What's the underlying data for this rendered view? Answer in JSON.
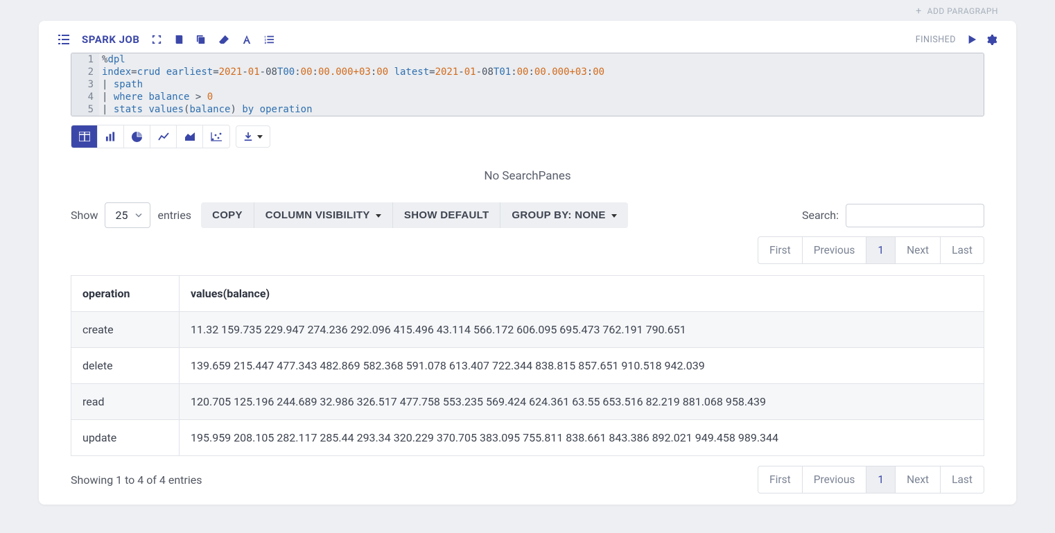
{
  "topbar": {
    "add_paragraph": "ADD PARAGRAPH"
  },
  "header": {
    "title": "SPARK JOB",
    "status": "FINISHED"
  },
  "editor": {
    "lines": [
      "1",
      "2",
      "3",
      "4",
      "5"
    ]
  },
  "code": {
    "l1_pct": "%",
    "l1_dpl": "dpl",
    "l2_index": "index",
    "l2_eq1": "=",
    "l2_crud": "crud",
    "l2_sp1": " ",
    "l2_earliest": "earliest",
    "l2_eq2": "=",
    "l2_2021a": "2021",
    "l2_da1": "-",
    "l2_01a": "01",
    "l2_da2": "-08",
    "l2_T1": "T00",
    "l2_c1": ":",
    "l2_00a": "00",
    "l2_c2": ":",
    "l2_tail1": "00.000+03",
    "l2_c3": ":",
    "l2_00b": "00",
    "l2_sp2": " ",
    "l2_latest": "latest",
    "l2_eq3": "=",
    "l2_2021b": "2021",
    "l2_da3": "-",
    "l2_01b": "01",
    "l2_da4": "-08",
    "l2_T2": "T01",
    "l2_c4": ":",
    "l2_00c": "00",
    "l2_c5": ":",
    "l2_tail2": "00.000+03",
    "l2_c6": ":",
    "l2_00d": "00",
    "l3_pipe": "| ",
    "l3_spath": "spath",
    "l4_pipe": "| ",
    "l4_where": "where",
    "l4_sp": " ",
    "l4_balance": "balance",
    "l4_gt": " > ",
    "l4_zero": "0",
    "l5_pipe": "| ",
    "l5_stats": "stats",
    "l5_sp1": " ",
    "l5_values": "values",
    "l5_lp": "(",
    "l5_balance": "balance",
    "l5_rp": ")",
    "l5_sp2": " ",
    "l5_by": "by",
    "l5_sp3": " ",
    "l5_operation": "operation"
  },
  "panes": {
    "none": "No SearchPanes"
  },
  "table_controls": {
    "show": "Show",
    "page_size": "25",
    "entries": "entries",
    "copy": "COPY",
    "col_vis": "COLUMN VISIBILITY",
    "show_default": "SHOW DEFAULT",
    "group_by": "GROUP BY: NONE",
    "search_label": "Search:"
  },
  "pagination": {
    "first": "First",
    "previous": "Previous",
    "page": "1",
    "next": "Next",
    "last": "Last"
  },
  "table": {
    "headers": {
      "operation": "operation",
      "values": "values(balance)"
    },
    "rows": [
      {
        "operation": "create",
        "values": "11.32 159.735 229.947 274.236 292.096 415.496 43.114 566.172 606.095 695.473 762.191 790.651"
      },
      {
        "operation": "delete",
        "values": "139.659 215.447 477.343 482.869 582.368 591.078 613.407 722.344 838.815 857.651 910.518 942.039"
      },
      {
        "operation": "read",
        "values": "120.705 125.196 244.689 32.986 326.517 477.758 553.235 569.424 624.361 63.55 653.516 82.219 881.068 958.439"
      },
      {
        "operation": "update",
        "values": "195.959 208.105 282.117 285.44 293.34 320.229 370.705 383.095 755.811 838.661 843.386 892.021 949.458 989.344"
      }
    ]
  },
  "footer": {
    "info": "Showing 1 to 4 of 4 entries"
  }
}
